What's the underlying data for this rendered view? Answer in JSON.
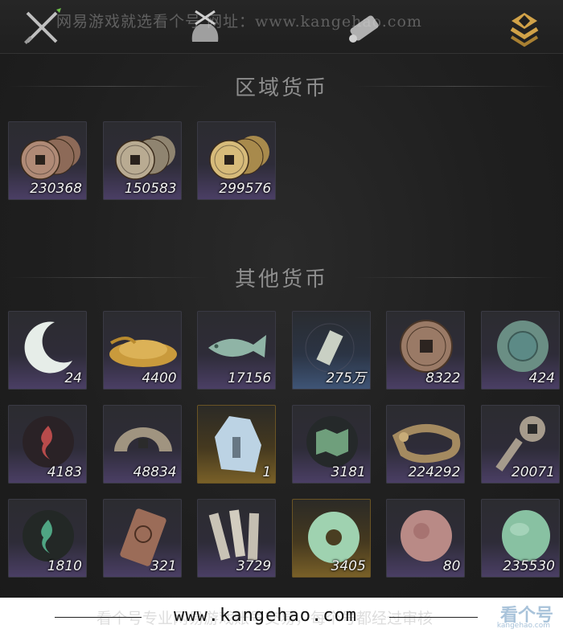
{
  "watermark_top": "网易游戏就选看个号  网址：www.kangehao.com",
  "tabs": [
    {
      "name": "crossed-swords-icon",
      "active": false
    },
    {
      "name": "money-bag-icon",
      "active": false
    },
    {
      "name": "scroll-icon",
      "active": false
    },
    {
      "name": "coin-tab-icon",
      "active": true
    }
  ],
  "sections": {
    "regional": {
      "title": "区域货币",
      "items": [
        {
          "icon": "copper-coins-icon",
          "qty": "230368"
        },
        {
          "icon": "silver-coins-icon",
          "qty": "150583"
        },
        {
          "icon": "gold-coins-icon",
          "qty": "299576"
        }
      ]
    },
    "other": {
      "title": "其他货币",
      "items": [
        {
          "icon": "jade-crescent-icon",
          "qty": "24"
        },
        {
          "icon": "grain-pile-icon",
          "qty": "4400"
        },
        {
          "icon": "jade-fish-icon",
          "qty": "17156"
        },
        {
          "icon": "jade-token-icon",
          "qty": "275万"
        },
        {
          "icon": "bronze-coin-icon",
          "qty": "8322"
        },
        {
          "icon": "teal-disc-icon",
          "qty": "424"
        },
        {
          "icon": "red-flame-emblem-icon",
          "qty": "4183"
        },
        {
          "icon": "half-coin-icon",
          "qty": "48834"
        },
        {
          "icon": "spirit-stone-icon",
          "qty": "1"
        },
        {
          "icon": "green-map-icon",
          "qty": "3181"
        },
        {
          "icon": "coin-string-icon",
          "qty": "224292"
        },
        {
          "icon": "key-coin-icon",
          "qty": "20071"
        },
        {
          "icon": "green-flame-emblem-icon",
          "qty": "1810"
        },
        {
          "icon": "bronze-plaque-icon",
          "qty": "321"
        },
        {
          "icon": "bamboo-slips-icon",
          "qty": "3729"
        },
        {
          "icon": "jade-ring-icon",
          "qty": "3405"
        },
        {
          "icon": "red-stone-icon",
          "qty": "80"
        },
        {
          "icon": "jade-pebble-icon",
          "qty": "235530"
        }
      ]
    }
  },
  "footer": {
    "url": "www.kangehao.com",
    "watermark": "看个号专业网易游戏账号交易，每个号都经过审核",
    "logo_text": "看个号",
    "logo_sub": "kangehao.com"
  },
  "colors": {
    "cell_purple": "#4b3f66",
    "cell_gold": "#7a6128",
    "cell_blue": "#3f5577",
    "active_tab": "#c89a3a"
  }
}
